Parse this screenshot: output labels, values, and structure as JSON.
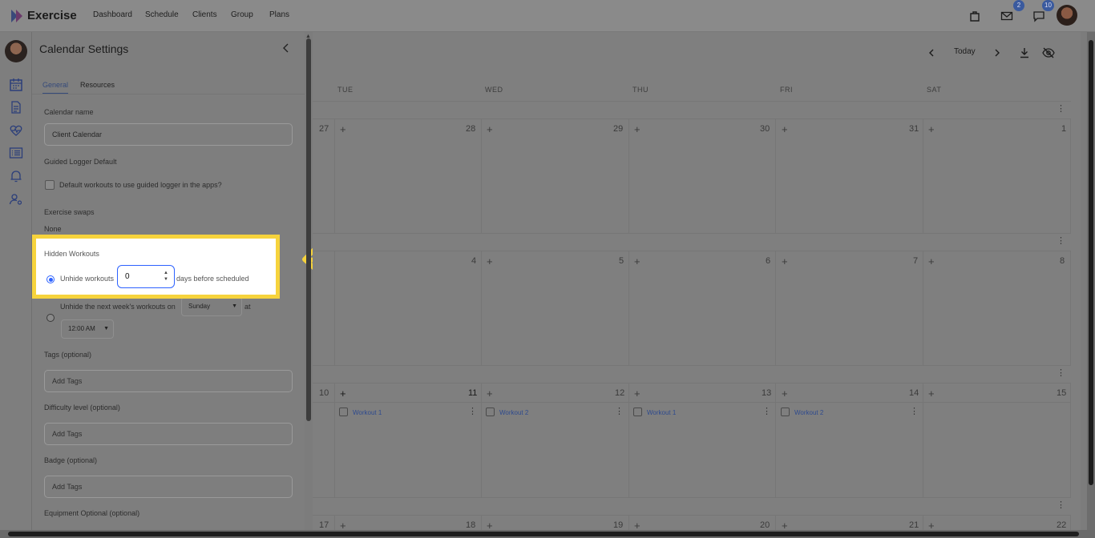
{
  "app": {
    "title": "Exercise",
    "nav": [
      "Dashboard",
      "Schedule",
      "Clients",
      "Group",
      "Plans"
    ],
    "mail_badge": "2",
    "chat_badge": "10"
  },
  "panel": {
    "title": "Calendar Settings",
    "tabs": [
      "General",
      "Resources"
    ],
    "calendar_name_label": "Calendar name",
    "calendar_name_value": "Client Calendar",
    "guided_logger_label": "Guided Logger Default",
    "guided_logger_checkbox": "Default workouts to use guided logger in the apps?",
    "exercise_swaps_label": "Exercise swaps",
    "exercise_swaps_value": "None",
    "hidden_workouts_label": "Hidden Workouts",
    "unhide_label": "Unhide workouts",
    "unhide_days_value": "0",
    "unhide_suffix": "days before scheduled",
    "next_week_label": "Unhide the next week's workouts on",
    "next_week_day": "Sunday",
    "at_label": "at",
    "next_week_time": "12:00 AM",
    "tags_label": "Tags (optional)",
    "tags_placeholder": "Add Tags",
    "difficulty_label": "Difficulty level (optional)",
    "difficulty_placeholder": "Add Tags",
    "badge_label": "Badge (optional)",
    "badge_placeholder": "Add Tags",
    "equipment_label": "Equipment Optional (optional)"
  },
  "calendar": {
    "today_label": "Today",
    "day_headers": [
      "TUE",
      "WED",
      "THU",
      "FRI",
      "SAT"
    ],
    "week1": [
      "27",
      "28",
      "29",
      "30",
      "31",
      "1"
    ],
    "week2": [
      "4",
      "5",
      "6",
      "7",
      "8"
    ],
    "week3": [
      "10",
      "11",
      "12",
      "13",
      "14",
      "15"
    ],
    "week4": [
      "17",
      "18",
      "19",
      "20",
      "21",
      "22"
    ],
    "workouts": [
      "Workout 1",
      "Workout 2",
      "Workout 1",
      "Workout 2"
    ]
  },
  "colors": {
    "highlight_border": "#f6d33c",
    "arrow": "#f6d33c",
    "accent": "#2d62ff"
  }
}
